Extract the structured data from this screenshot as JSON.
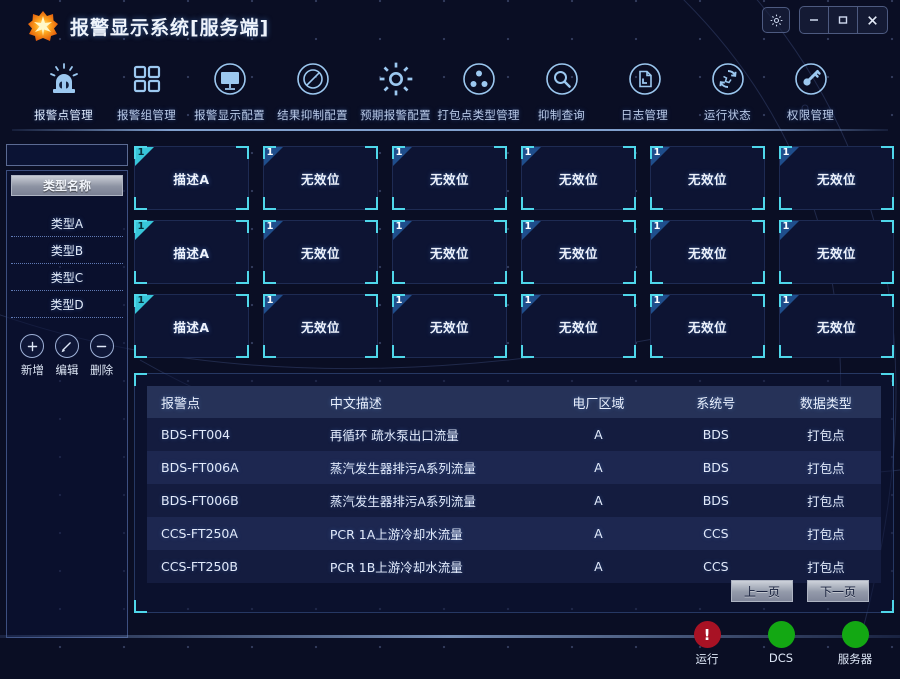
{
  "window": {
    "title": "报警显示系统[服务端]",
    "logo_icon": "starburst-logo",
    "settings_icon": "gear-icon",
    "minimize_label": "—",
    "maximize_label": "❐",
    "close_label": "✕"
  },
  "toolbar": {
    "items": [
      {
        "label": "报警点管理",
        "icon": "alarm-beacon-icon",
        "active": true
      },
      {
        "label": "报警组管理",
        "icon": "grid-squares-icon",
        "active": false
      },
      {
        "label": "报警显示配置",
        "icon": "monitor-icon",
        "active": false
      },
      {
        "label": "结果抑制配置",
        "icon": "no-entry-icon",
        "active": false
      },
      {
        "label": "预期报警配置",
        "icon": "gear-icon",
        "active": false
      },
      {
        "label": "打包点类型管理",
        "icon": "nodes-icon",
        "active": false
      },
      {
        "label": "抑制查询",
        "icon": "search-icon",
        "active": false
      },
      {
        "label": "日志管理",
        "icon": "document-icon",
        "active": false
      },
      {
        "label": "运行状态",
        "icon": "globe-refresh-icon",
        "active": false
      },
      {
        "label": "权限管理",
        "icon": "key-icon",
        "active": false
      }
    ]
  },
  "sidebar": {
    "search": {
      "value": "",
      "placeholder": "",
      "icon": "search-icon"
    },
    "list_header": "类型名称",
    "types": [
      {
        "label": "类型A"
      },
      {
        "label": "类型B"
      },
      {
        "label": "类型C"
      },
      {
        "label": "类型D"
      }
    ],
    "actions": [
      {
        "label": "新增",
        "glyph": "+",
        "icon": "plus-circle-icon"
      },
      {
        "label": "编辑",
        "glyph": "✎",
        "icon": "pencil-circle-icon"
      },
      {
        "label": "删除",
        "glyph": "−",
        "icon": "minus-circle-icon"
      }
    ]
  },
  "grid": {
    "cards": [
      {
        "badge": "1",
        "text": "描述A",
        "accent": "cyan"
      },
      {
        "badge": "1",
        "text": "无效位",
        "accent": "blue"
      },
      {
        "badge": "1",
        "text": "无效位",
        "accent": "blue"
      },
      {
        "badge": "1",
        "text": "无效位",
        "accent": "blue"
      },
      {
        "badge": "1",
        "text": "无效位",
        "accent": "blue"
      },
      {
        "badge": "1",
        "text": "无效位",
        "accent": "blue"
      },
      {
        "badge": "1",
        "text": "描述A",
        "accent": "cyan"
      },
      {
        "badge": "1",
        "text": "无效位",
        "accent": "blue"
      },
      {
        "badge": "1",
        "text": "无效位",
        "accent": "blue"
      },
      {
        "badge": "1",
        "text": "无效位",
        "accent": "blue"
      },
      {
        "badge": "1",
        "text": "无效位",
        "accent": "blue"
      },
      {
        "badge": "1",
        "text": "无效位",
        "accent": "blue"
      },
      {
        "badge": "1",
        "text": "描述A",
        "accent": "cyan"
      },
      {
        "badge": "1",
        "text": "无效位",
        "accent": "blue"
      },
      {
        "badge": "1",
        "text": "无效位",
        "accent": "blue"
      },
      {
        "badge": "1",
        "text": "无效位",
        "accent": "blue"
      },
      {
        "badge": "1",
        "text": "无效位",
        "accent": "blue"
      },
      {
        "badge": "1",
        "text": "无效位",
        "accent": "blue"
      }
    ]
  },
  "table": {
    "columns": [
      "报警点",
      "中文描述",
      "电厂区域",
      "系统号",
      "数据类型"
    ],
    "rows": [
      [
        "BDS-FT004",
        "再循环 疏水泵出口流量",
        "A",
        "BDS",
        "打包点"
      ],
      [
        "BDS-FT006A",
        "蒸汽发生器排污A系列流量",
        "A",
        "BDS",
        "打包点"
      ],
      [
        "BDS-FT006B",
        "蒸汽发生器排污A系列流量",
        "A",
        "BDS",
        "打包点"
      ],
      [
        "CCS-FT250A",
        "PCR 1A上游冷却水流量",
        "A",
        "CCS",
        "打包点"
      ],
      [
        "CCS-FT250B",
        "PCR 1B上游冷却水流量",
        "A",
        "CCS",
        "打包点"
      ]
    ],
    "prev_label": "上一页",
    "next_label": "下一页"
  },
  "status": [
    {
      "label": "运行",
      "color": "#a81224",
      "glyph": "!",
      "icon": "alert-status-icon"
    },
    {
      "label": "DCS",
      "color": "#13a813",
      "glyph": "",
      "icon": "dcs-status-icon"
    },
    {
      "label": "服务器",
      "color": "#13a813",
      "glyph": "",
      "icon": "server-status-icon"
    }
  ],
  "colors": {
    "background": "#0a0e24",
    "accent_cyan": "#4fd7ea",
    "accent_blue": "#1f4e8c",
    "ok_green": "#13a813",
    "alert_red": "#a81224"
  }
}
